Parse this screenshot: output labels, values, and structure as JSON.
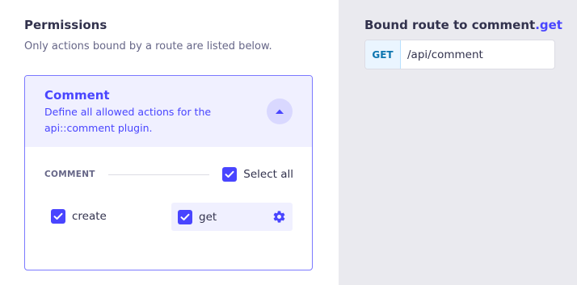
{
  "permissions": {
    "title": "Permissions",
    "subtitle": "Only actions bound by a route are listed below."
  },
  "plugin_card": {
    "title": "Comment",
    "description": "Define all allowed actions for the api::comment plugin.",
    "collapse_icon": "chevron-up-icon",
    "section_label": "COMMENT",
    "select_all_label": "Select all",
    "select_all_checked": true,
    "actions": [
      {
        "label": "create",
        "checked": true
      },
      {
        "label": "get",
        "checked": true,
        "settings_icon": "gear-icon"
      }
    ]
  },
  "bound_route": {
    "title_prefix": "Bound route to ",
    "title_controller": "comment",
    "title_action": ".get",
    "method": "GET",
    "path": "/api/comment"
  },
  "colors": {
    "accent": "#4945ff",
    "card_header_bg": "#f0f0ff",
    "right_panel_bg": "#eaeaef",
    "method_text": "#0c75af"
  }
}
